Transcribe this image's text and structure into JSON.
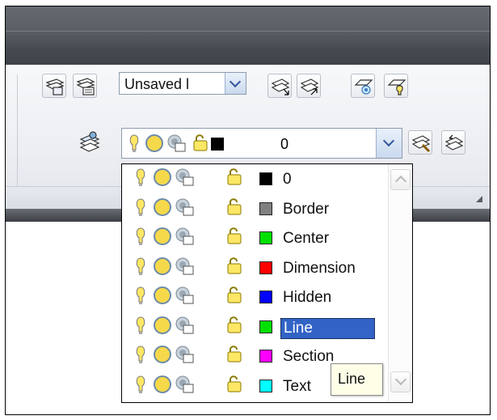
{
  "toolbar": {
    "layer_state_value": "Unsaved l",
    "current_layer_name": "0"
  },
  "layers": [
    {
      "name": "0",
      "color": "#000000"
    },
    {
      "name": "Border",
      "color": "#808080"
    },
    {
      "name": "Center",
      "color": "#00e000"
    },
    {
      "name": "Dimension",
      "color": "#ff0000"
    },
    {
      "name": "Hidden",
      "color": "#0000ff"
    },
    {
      "name": "Line",
      "color": "#00e000"
    },
    {
      "name": "Section",
      "color": "#ff00ff"
    },
    {
      "name": "Text",
      "color": "#00ffff"
    }
  ],
  "selected_layer": "Line",
  "tooltip": "Line",
  "colors": {
    "accent_selection": "#3263c5",
    "bulb_on": "#ffe766",
    "sun_thaw": "#f5d94a"
  },
  "icons": [
    "lightbulb-on-icon",
    "sun-thaw-icon",
    "viewport-freeze-icon",
    "lock-open-icon",
    "layer-stack-icon"
  ]
}
